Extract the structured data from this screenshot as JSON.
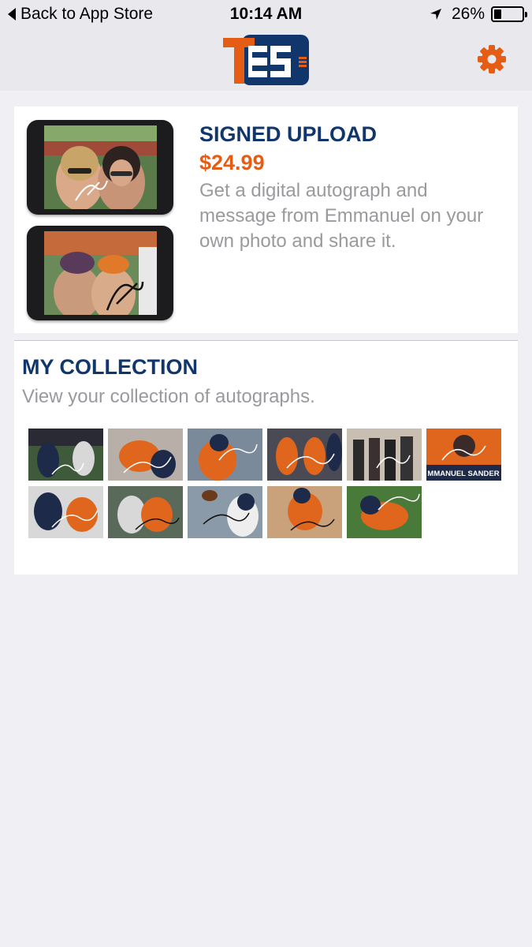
{
  "status_bar": {
    "back_label": "Back to App Store",
    "time": "10:14 AM",
    "battery": "26%",
    "battery_level": 0.26
  },
  "nav": {
    "logo_text": "ES",
    "logo_letter": "T",
    "settings_icon": "gear-icon",
    "accent_color": "#e55c14",
    "brand_color": "#10366b"
  },
  "signed_upload": {
    "title": "SIGNED UPLOAD",
    "price": "$24.99",
    "description": "Get a digital autograph and message from Emmanuel on your own photo and share it."
  },
  "collection": {
    "title": "MY COLLECTION",
    "description": "View your collection of autographs.",
    "thumbnail_count": 11,
    "thumbnail_caption": "MMANUEL SANDER"
  }
}
